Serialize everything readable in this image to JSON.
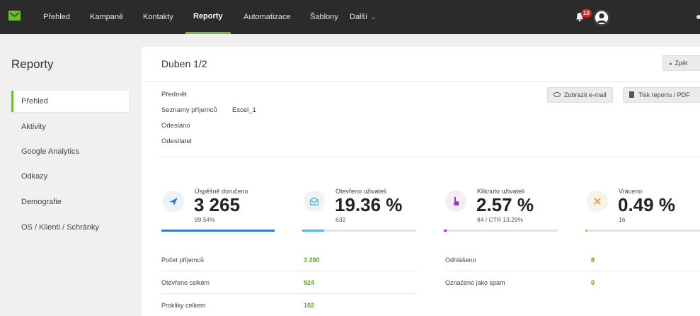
{
  "topnav": {
    "items": [
      {
        "label": "Přehled"
      },
      {
        "label": "Kampaně"
      },
      {
        "label": "Kontakty"
      },
      {
        "label": "Reporty"
      },
      {
        "label": "Automatizace"
      },
      {
        "label": "Šablony"
      },
      {
        "label": "Další"
      }
    ],
    "active": "Reporty",
    "notification_count": "10",
    "icons": {
      "logo": "envelope-logo-icon",
      "bell": "bell-icon",
      "avatar": "user-avatar-icon",
      "more": "chevron-down-icon"
    }
  },
  "sidebar": {
    "title": "Reporty",
    "items": [
      {
        "label": "Přehled"
      },
      {
        "label": "Aktivity"
      },
      {
        "label": "Google Analytics"
      },
      {
        "label": "Odkazy"
      },
      {
        "label": "Demografie"
      },
      {
        "label": "OS / Klienti / Schránky"
      }
    ],
    "active": "Přehled"
  },
  "main": {
    "title": "Duben 1/2",
    "back_label": "Zpět",
    "show_email_label": "Zobrazit e-mail",
    "print_label": "Tisk reportu / PDF",
    "info": {
      "subject_label": "Předmět",
      "lists_label": "Seznamy příjemců",
      "lists_value": "Excel_1",
      "sent_label": "Odesláno",
      "sender_label": "Odesílatel"
    },
    "stats": [
      {
        "label": "Úspěšně doručeno",
        "value": "3 265",
        "sub": "99.54%",
        "progress": 0.9954,
        "color": "#2f80c8",
        "icon": "paper-plane-icon"
      },
      {
        "label": "Otevřeno uživateli",
        "value": "19.36 %",
        "sub": "632",
        "progress": 0.1936,
        "color": "#5bb5e0",
        "icon": "envelope-open-icon"
      },
      {
        "label": "Kliknuto uživateli",
        "value": "2.57 %",
        "sub": "84 / CTR 13.29%",
        "progress": 0.0257,
        "color": "#a52fd6",
        "icon": "pointer-hand-icon"
      },
      {
        "label": "Vráceno",
        "value": "0.49 %",
        "sub": "16",
        "progress": 0.0049,
        "color": "#f0a830",
        "icon": "close-x-icon"
      }
    ],
    "table_left": [
      {
        "label": "Počet příjemců",
        "value": "3 280"
      },
      {
        "label": "Otevřeno celkem",
        "value": "924"
      },
      {
        "label": "Prokliky celkem",
        "value": "102"
      }
    ],
    "table_right": [
      {
        "label": "Odhlášeno",
        "value": "8"
      },
      {
        "label": "Označeno jako spam",
        "value": "0"
      }
    ],
    "accent": "#6cbf2a"
  }
}
